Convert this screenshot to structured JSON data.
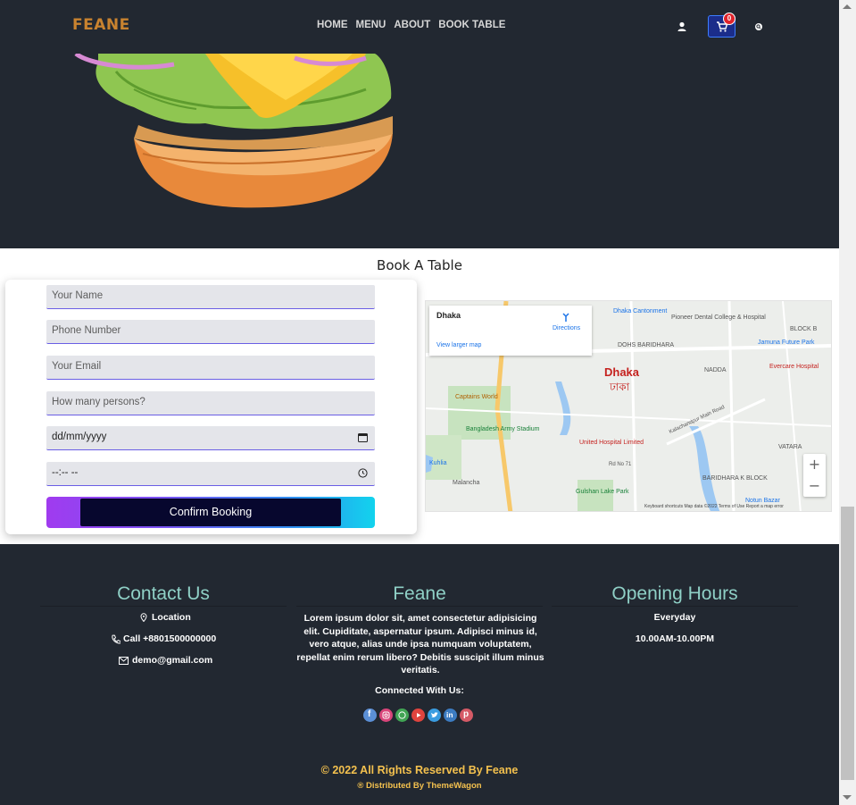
{
  "header": {
    "brand": "FEANE",
    "nav": [
      "HOME",
      "MENU",
      "ABOUT",
      "BOOK TABLE"
    ],
    "cart_count": "0"
  },
  "booking": {
    "title": "Book A Table",
    "fields": {
      "name": "Your Name",
      "phone": "Phone Number",
      "email": "Your Email",
      "persons": "How many persons?",
      "date": "dd/mm/yyyy",
      "time": "--:-- --"
    },
    "button": "Confirm Booking"
  },
  "map": {
    "place": "Dhaka",
    "directions": "Directions",
    "larger": "View larger map",
    "city_en": "Dhaka",
    "city_bn": "ঢাকা",
    "labels": {
      "dohs": "DOHS BARIDHARA",
      "nadda": "NADDA",
      "block_b": "BLOCK B",
      "vatara": "VATARA",
      "baridhara_k": "BARIDHARA K BLOCK",
      "cantonment": "Dhaka Cantonment",
      "pioneer": "Pioneer Dental College & Hospital",
      "jamuna": "Jamuna Future Park",
      "evercare": "Evercare Hospital",
      "captains": "Captains World",
      "stadium": "Bangladesh Army Stadium",
      "united": "United Hospital Limited",
      "gulshan": "Gulshan Lake Park",
      "kuhlia": "Kuhlia",
      "malancha": "Malancha",
      "notun_bazar": "Notun Bazar",
      "kalachandpur": "Kalachandpur Main Road",
      "rd71": "Rd No 71"
    },
    "attribution": "Keyboard shortcuts   Map data ©2022   Terms of Use   Report a map error",
    "zoom_in": "+",
    "zoom_out": "−"
  },
  "footer": {
    "contact": {
      "title": "Contact Us",
      "location": "Location",
      "phone": "Call +8801500000000",
      "email": "demo@gmail.com"
    },
    "about": {
      "title": "Feane",
      "desc": "Lorem ipsum dolor sit, amet consectetur adipisicing elit. Cupiditate, aspernatur ipsum. Adipisci minus id, vero atque, alias unde ipsa numquam voluptatem, repellat enim rerum libero? Debitis suscipit illum minus veritatis.",
      "connected": "Connected With Us:"
    },
    "hours": {
      "title": "Opening Hours",
      "days": "Everyday",
      "time": "10.00AM-10.00PM"
    },
    "copyright": "© 2022 All Rights Reserved By Feane",
    "distributed": "® Distributed By ThemeWagon"
  },
  "colors": {
    "dark": "#222831",
    "brand": "#c9832f",
    "footer_title": "#8fd0c6",
    "copyright": "#f4c14e"
  }
}
